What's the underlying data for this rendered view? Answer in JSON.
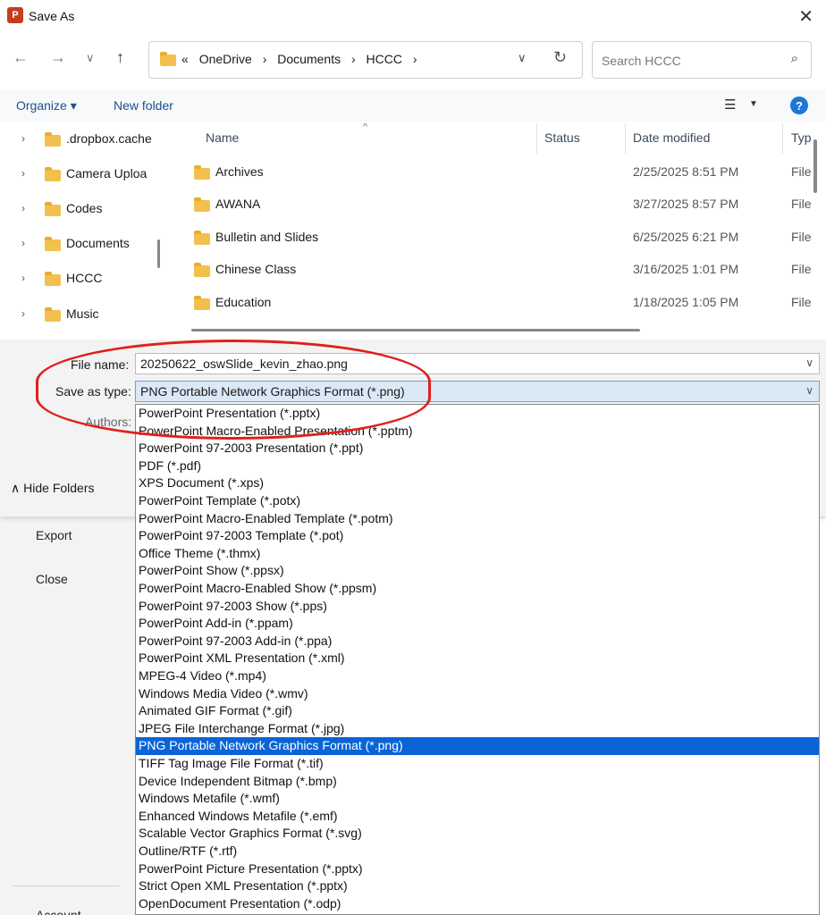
{
  "backstage": {
    "export_label": "Export",
    "close_label": "Close",
    "account_label": "Account"
  },
  "window": {
    "title": "Save As",
    "app_icon_letter": "P"
  },
  "address": {
    "breadcrumbs": [
      "«",
      "OneDrive",
      "›",
      "Documents",
      "›",
      "HCCC",
      "›"
    ],
    "search_placeholder": "Search HCCC"
  },
  "toolbar": {
    "organize_label": "Organize ▾",
    "new_folder_label": "New folder"
  },
  "nav_tree": [
    ".dropbox.cache",
    "Camera Uploa",
    "Codes",
    "Documents",
    "HCCC",
    "Music"
  ],
  "columns": {
    "name": "Name",
    "status": "Status",
    "date": "Date modified",
    "type": "Typ"
  },
  "files": [
    {
      "name": "Archives",
      "date": "2/25/2025 8:51 PM",
      "type": "File"
    },
    {
      "name": "AWANA",
      "date": "3/27/2025 8:57 PM",
      "type": "File"
    },
    {
      "name": "Bulletin and Slides",
      "date": "6/25/2025 6:21 PM",
      "type": "File"
    },
    {
      "name": "Chinese Class",
      "date": "3/16/2025 1:01 PM",
      "type": "File"
    },
    {
      "name": "Education",
      "date": "1/18/2025 1:05 PM",
      "type": "File"
    }
  ],
  "form": {
    "file_name_label": "File name:",
    "file_name_value": "20250622_oswSlide_kevin_zhao.png",
    "save_type_label": "Save as type:",
    "save_type_value": "PNG Portable Network Graphics Format (*.png)",
    "authors_label": "Authors:",
    "hide_folders_label": "Hide Folders"
  },
  "save_types": [
    "PowerPoint Presentation (*.pptx)",
    "PowerPoint Macro-Enabled Presentation (*.pptm)",
    "PowerPoint 97-2003 Presentation (*.ppt)",
    "PDF (*.pdf)",
    "XPS Document (*.xps)",
    "PowerPoint Template (*.potx)",
    "PowerPoint Macro-Enabled Template (*.potm)",
    "PowerPoint 97-2003 Template (*.pot)",
    "Office Theme (*.thmx)",
    "PowerPoint Show (*.ppsx)",
    "PowerPoint Macro-Enabled Show (*.ppsm)",
    "PowerPoint 97-2003 Show (*.pps)",
    "PowerPoint Add-in (*.ppam)",
    "PowerPoint 97-2003 Add-in (*.ppa)",
    "PowerPoint XML Presentation (*.xml)",
    "MPEG-4 Video (*.mp4)",
    "Windows Media Video (*.wmv)",
    "Animated GIF Format (*.gif)",
    "JPEG File Interchange Format (*.jpg)",
    "PNG Portable Network Graphics Format (*.png)",
    "TIFF Tag Image File Format (*.tif)",
    "Device Independent Bitmap (*.bmp)",
    "Windows Metafile (*.wmf)",
    "Enhanced Windows Metafile (*.emf)",
    "Scalable Vector Graphics Format (*.svg)",
    "Outline/RTF (*.rtf)",
    "PowerPoint Picture Presentation (*.pptx)",
    "Strict Open XML Presentation (*.pptx)",
    "OpenDocument Presentation (*.odp)"
  ],
  "selected_type_index": 19,
  "colors": {
    "accent": "#0a64d6",
    "annotation": "#e0201b"
  }
}
